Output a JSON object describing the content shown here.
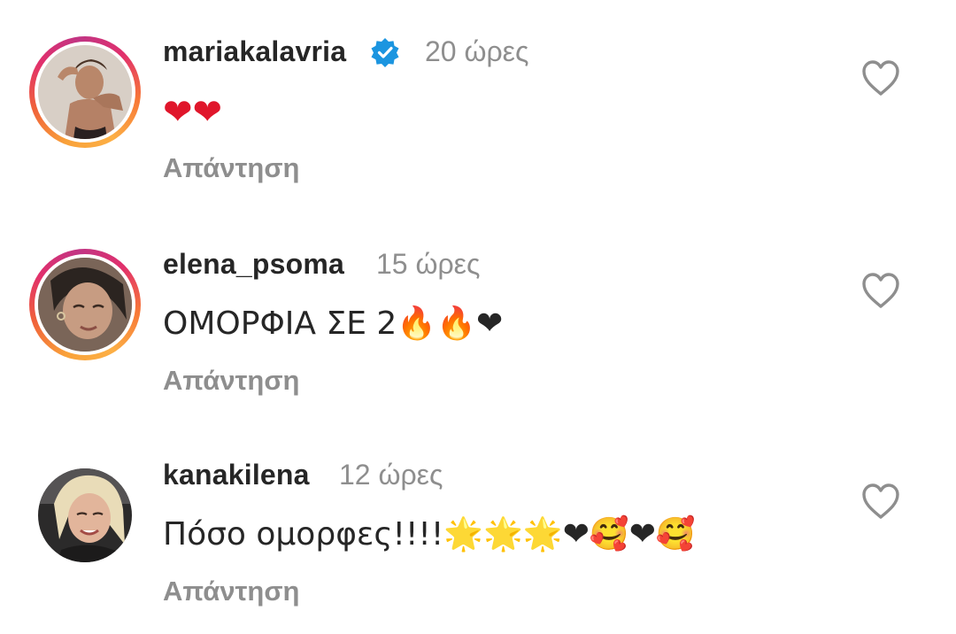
{
  "comments": [
    {
      "username": "mariakalavria",
      "verified": true,
      "time": "20 ώρες",
      "text": "❤❤",
      "reply_label": "Απάντηση",
      "has_story_ring": true
    },
    {
      "username": "elena_psoma",
      "verified": false,
      "time": "15 ώρες",
      "text": "ΟΜΟΡΦΙΑ ΣΕ 2🔥🔥❤",
      "reply_label": "Απάντηση",
      "has_story_ring": true
    },
    {
      "username": "kanakilena",
      "verified": false,
      "time": "12 ώρες",
      "text": "Πόσο ομορφες!!!!🌟🌟🌟❤🥰❤🥰",
      "reply_label": "Απάντηση",
      "has_story_ring": false
    }
  ],
  "colors": {
    "username": "#262626",
    "muted": "#8e8e8e",
    "verified_badge": "#1b95e0",
    "heart_emoji": "#e0162b"
  },
  "icons": {
    "like": "heart-outline-icon",
    "verified": "verified-badge-icon"
  }
}
